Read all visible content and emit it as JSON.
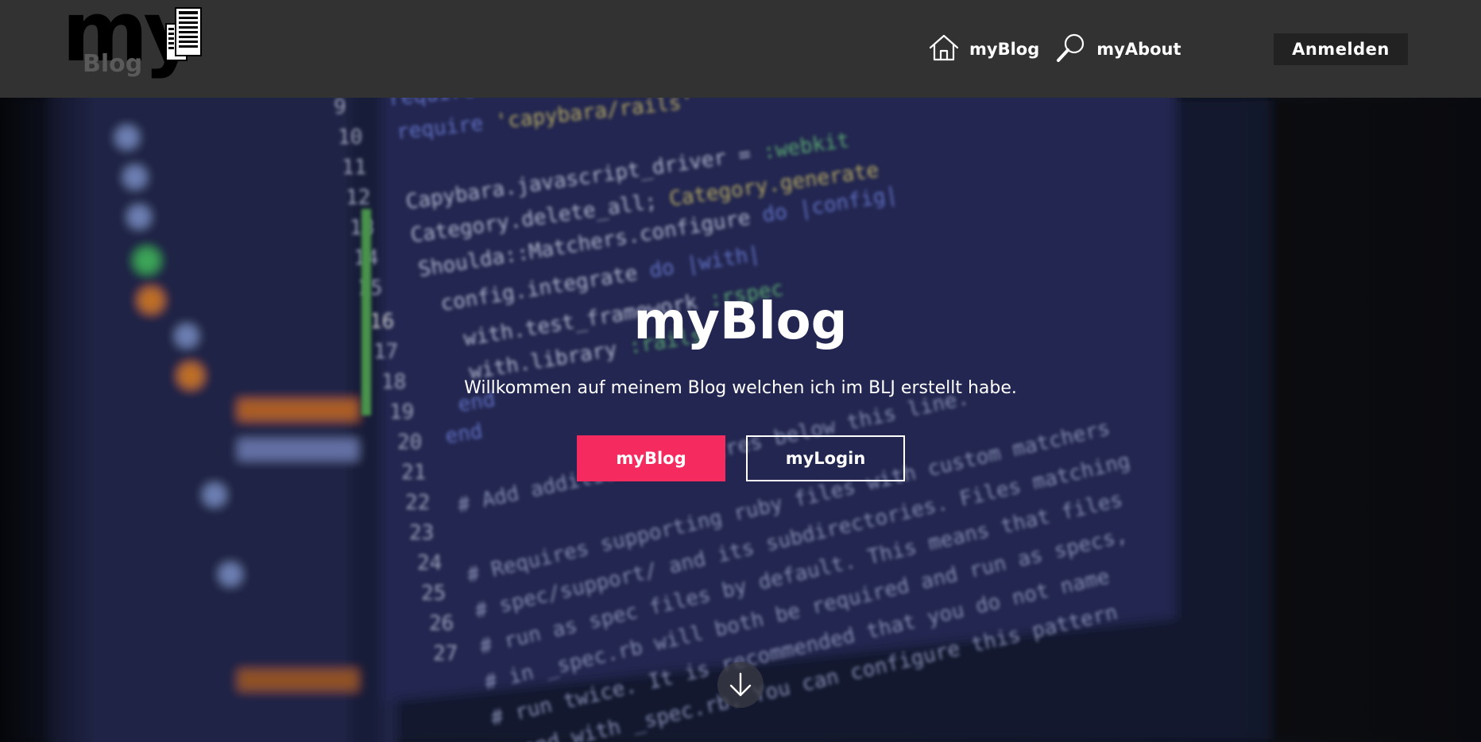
{
  "header": {
    "logo": {
      "main": "my",
      "sub": "Blog"
    },
    "nav": [
      {
        "label": "myBlog",
        "icon": "home-icon"
      },
      {
        "label": "myAbout",
        "icon": "magnifier-icon"
      }
    ],
    "signin_label": "Anmelden"
  },
  "hero": {
    "title": "myBlog",
    "subtitle": "Willkommen auf meinem Blog welchen ich im BLJ erstellt habe.",
    "primary_button": "myBlog",
    "secondary_button": "myLogin",
    "scroll_icon": "arrow-down-icon"
  },
  "colors": {
    "navbar": "#323232",
    "signin_button": "#222222",
    "accent": "#f52a5f",
    "text": "#ffffff"
  }
}
